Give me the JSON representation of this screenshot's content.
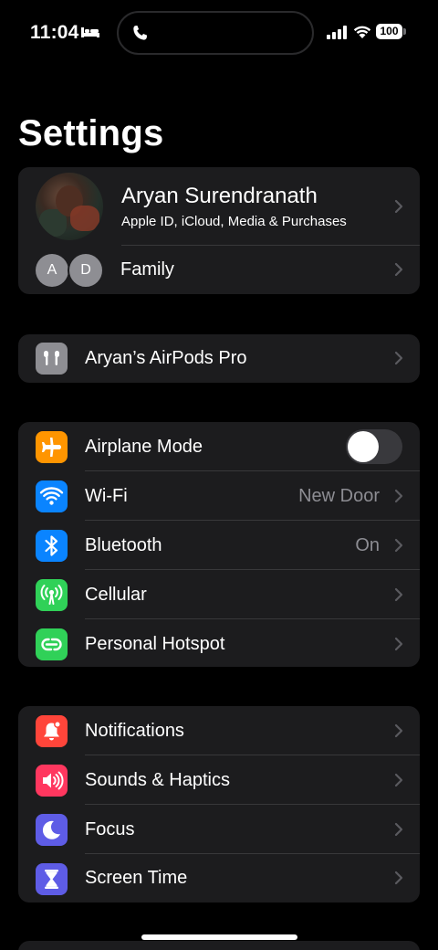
{
  "status_bar": {
    "time": "11:04",
    "battery": "100"
  },
  "title": "Settings",
  "profile": {
    "name": "Aryan Surendranath",
    "subtitle": "Apple ID, iCloud, Media & Purchases",
    "family_label": "Family",
    "family_initials": [
      "A",
      "D"
    ]
  },
  "airpods": {
    "label": "Aryan’s AirPods Pro"
  },
  "connectivity": [
    {
      "label": "Airplane Mode",
      "toggle": "off",
      "icon": "airplane-icon",
      "color": "#ff9500"
    },
    {
      "label": "Wi-Fi",
      "value": "New Door",
      "icon": "wifi-icon",
      "color": "#0a84ff"
    },
    {
      "label": "Bluetooth",
      "value": "On",
      "icon": "bluetooth-icon",
      "color": "#0a84ff"
    },
    {
      "label": "Cellular",
      "icon": "antenna-icon",
      "color": "#30d158"
    },
    {
      "label": "Personal Hotspot",
      "icon": "hotspot-icon",
      "color": "#30d158"
    }
  ],
  "notifications_group": [
    {
      "label": "Notifications",
      "icon": "bell-icon",
      "color": "#ff453a"
    },
    {
      "label": "Sounds & Haptics",
      "icon": "speaker-icon",
      "color": "#ff375f"
    },
    {
      "label": "Focus",
      "icon": "moon-icon",
      "color": "#5e5ce6"
    },
    {
      "label": "Screen Time",
      "icon": "hourglass-icon",
      "color": "#5e5ce6"
    }
  ]
}
